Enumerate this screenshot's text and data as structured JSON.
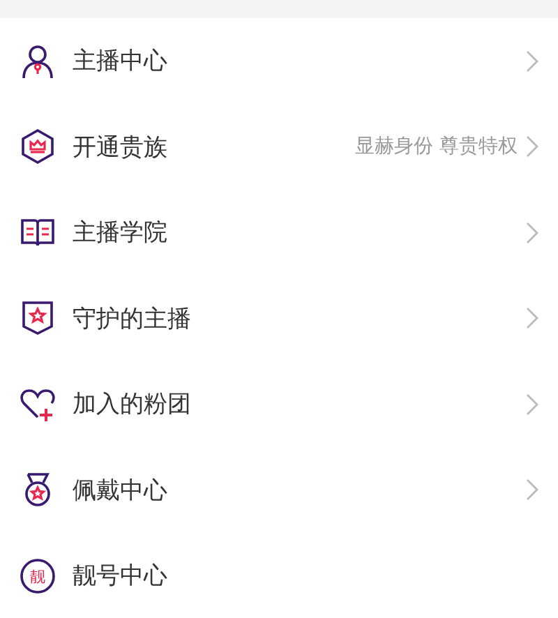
{
  "menu": [
    {
      "kind": "anchor",
      "label": "主播中心",
      "chevron": true
    },
    {
      "kind": "noble",
      "label": "开通贵族",
      "hint": "显赫身份 尊贵特权",
      "chevron": true
    },
    {
      "kind": "academy",
      "label": "主播学院",
      "chevron": true
    },
    {
      "kind": "guard",
      "label": "守护的主播",
      "chevron": true
    },
    {
      "kind": "fans",
      "label": "加入的粉团",
      "chevron": true
    },
    {
      "kind": "medal",
      "label": "佩戴中心",
      "chevron": true
    },
    {
      "kind": "number",
      "label": "靓号中心",
      "icon_text": "靓",
      "chevron": false
    }
  ]
}
